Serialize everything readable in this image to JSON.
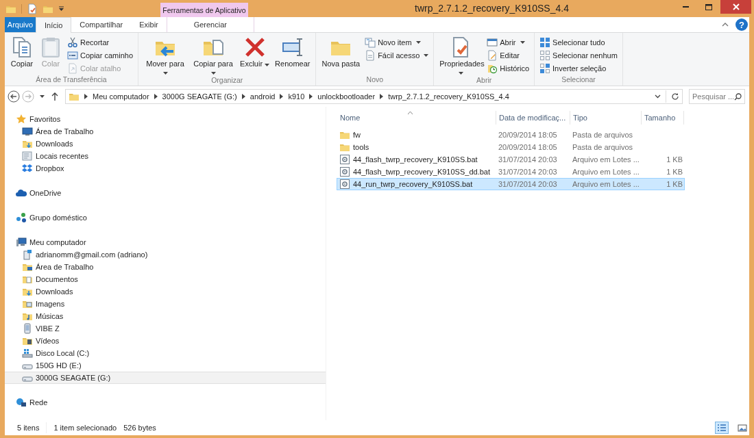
{
  "window": {
    "title": "twrp_2.7.1.2_recovery_K910SS_4.4",
    "context_group": "Ferramentas de Aplicativo"
  },
  "ribbon": {
    "tabs": [
      {
        "label": "Arquivo",
        "kind": "file",
        "selected": false
      },
      {
        "label": "Início",
        "kind": "normal",
        "selected": true
      },
      {
        "label": "Compartilhar",
        "kind": "normal",
        "selected": false
      },
      {
        "label": "Exibir",
        "kind": "normal",
        "selected": false
      },
      {
        "label": "Gerenciar",
        "kind": "context",
        "selected": false
      }
    ],
    "help": "?",
    "groups": [
      {
        "label": "Área de Transferência",
        "large": [
          {
            "label": "Copiar",
            "kind": "copy",
            "disabled": false,
            "dropdown": false
          },
          {
            "label": "Colar",
            "kind": "paste",
            "disabled": true,
            "dropdown": false
          }
        ],
        "small": [
          {
            "label": "Recortar",
            "kind": "cut",
            "disabled": false,
            "dropdown": false
          },
          {
            "label": "Copiar caminho",
            "kind": "copypath",
            "disabled": false,
            "dropdown": false
          },
          {
            "label": "Colar atalho",
            "kind": "shortcut",
            "disabled": true,
            "dropdown": false
          }
        ]
      },
      {
        "label": "Organizar",
        "large": [
          {
            "label": "Mover para",
            "kind": "move",
            "disabled": false,
            "dropdown": true
          },
          {
            "label": "Copiar para",
            "kind": "copyto",
            "disabled": false,
            "dropdown": true
          },
          {
            "label": "Excluir",
            "kind": "delete",
            "disabled": false,
            "dropdown": true
          },
          {
            "label": "Renomear",
            "kind": "rename",
            "disabled": false,
            "dropdown": false
          }
        ]
      },
      {
        "label": "Novo",
        "large": [
          {
            "label": "Nova pasta",
            "kind": "folder",
            "disabled": false,
            "dropdown": false
          }
        ],
        "small": [
          {
            "label": "Novo item",
            "kind": "newitem",
            "disabled": false,
            "dropdown": true
          },
          {
            "label": "Fácil acesso",
            "kind": "easy",
            "disabled": false,
            "dropdown": true
          }
        ]
      },
      {
        "label": "Abrir",
        "large": [
          {
            "label": "Propriedades",
            "kind": "properties",
            "disabled": false,
            "dropdown": true
          }
        ],
        "small": [
          {
            "label": "Abrir",
            "kind": "open",
            "disabled": false,
            "dropdown": true
          },
          {
            "label": "Editar",
            "kind": "edit",
            "disabled": false,
            "dropdown": false
          },
          {
            "label": "Histórico",
            "kind": "history",
            "disabled": false,
            "dropdown": false
          }
        ]
      },
      {
        "label": "Selecionar",
        "small": [
          {
            "label": "Selecionar tudo",
            "kind": "selectall",
            "disabled": false,
            "dropdown": false
          },
          {
            "label": "Selecionar nenhum",
            "kind": "selectnone",
            "disabled": false,
            "dropdown": false
          },
          {
            "label": "Inverter seleção",
            "kind": "invert",
            "disabled": false,
            "dropdown": false
          }
        ]
      }
    ]
  },
  "address": {
    "path": [
      "Meu computador",
      "3000G SEAGATE (G:)",
      "android",
      "k910",
      "unlockbootloader",
      "twrp_2.7.1.2_recovery_K910SS_4.4"
    ],
    "search_placeholder": "Pesquisar ..."
  },
  "navigation": [
    {
      "label": "Favoritos",
      "kind": "star",
      "selected": false,
      "children": [
        {
          "label": "Área de Trabalho",
          "kind": "desktop",
          "selected": false
        },
        {
          "label": "Downloads",
          "kind": "downloads",
          "selected": false
        },
        {
          "label": "Locais recentes",
          "kind": "recent",
          "selected": false
        },
        {
          "label": "Dropbox",
          "kind": "box",
          "selected": false
        }
      ]
    },
    {
      "label": "OneDrive",
      "kind": "cloud",
      "selected": false
    },
    {
      "label": "Grupo doméstico",
      "kind": "homegroup",
      "selected": false
    },
    {
      "label": "Meu computador",
      "kind": "computer",
      "selected": false,
      "children": [
        {
          "label": "adrianomm@gmail.com (adriano)",
          "kind": "netdrive",
          "selected": false
        },
        {
          "label": "Área de Trabalho",
          "kind": "desktopfolder",
          "selected": false
        },
        {
          "label": "Documentos",
          "kind": "documents",
          "selected": false
        },
        {
          "label": "Downloads",
          "kind": "downloads",
          "selected": false
        },
        {
          "label": "Imagens",
          "kind": "pictures",
          "selected": false
        },
        {
          "label": "Músicas",
          "kind": "music",
          "selected": false
        },
        {
          "label": "VIBE Z",
          "kind": "phone",
          "selected": false
        },
        {
          "label": "Vídeos",
          "kind": "videos",
          "selected": false
        },
        {
          "label": "Disco Local (C:)",
          "kind": "sysdrive",
          "selected": false
        },
        {
          "label": "150G HD (E:)",
          "kind": "drive",
          "selected": false
        },
        {
          "label": "3000G SEAGATE (G:)",
          "kind": "drive",
          "selected": true
        }
      ]
    },
    {
      "label": "Rede",
      "kind": "network",
      "selected": false
    }
  ],
  "files": {
    "columns": [
      "Nome",
      "Data de modificaç...",
      "Tipo",
      "Tamanho"
    ],
    "rows": [
      {
        "name": "fw",
        "kind": "folder",
        "date": "20/09/2014 18:05",
        "type": "Pasta de arquivos",
        "selected": false
      },
      {
        "name": "tools",
        "kind": "folder",
        "date": "20/09/2014 18:05",
        "type": "Pasta de arquivos",
        "selected": false
      },
      {
        "name": "44_flash_twrp_recovery_K910SS.bat",
        "kind": "batch",
        "date": "31/07/2014 20:03",
        "type": "Arquivo em Lotes ...",
        "size": "1 KB",
        "selected": false
      },
      {
        "name": "44_flash_twrp_recovery_K910SS_dd.bat",
        "kind": "batch",
        "date": "31/07/2014 20:03",
        "type": "Arquivo em Lotes ...",
        "size": "1 KB",
        "selected": false
      },
      {
        "name": "44_run_twrp_recovery_K910SS.bat",
        "kind": "batch",
        "date": "31/07/2014 20:03",
        "type": "Arquivo em Lotes ...",
        "size": "1 KB",
        "selected": true
      }
    ]
  },
  "status_bar": {
    "count": "5 itens",
    "selection": "1 item selecionado",
    "size": "526 bytes",
    "views": [
      {
        "kind": "details",
        "selected": true
      },
      {
        "kind": "large-icons",
        "selected": false
      }
    ]
  }
}
